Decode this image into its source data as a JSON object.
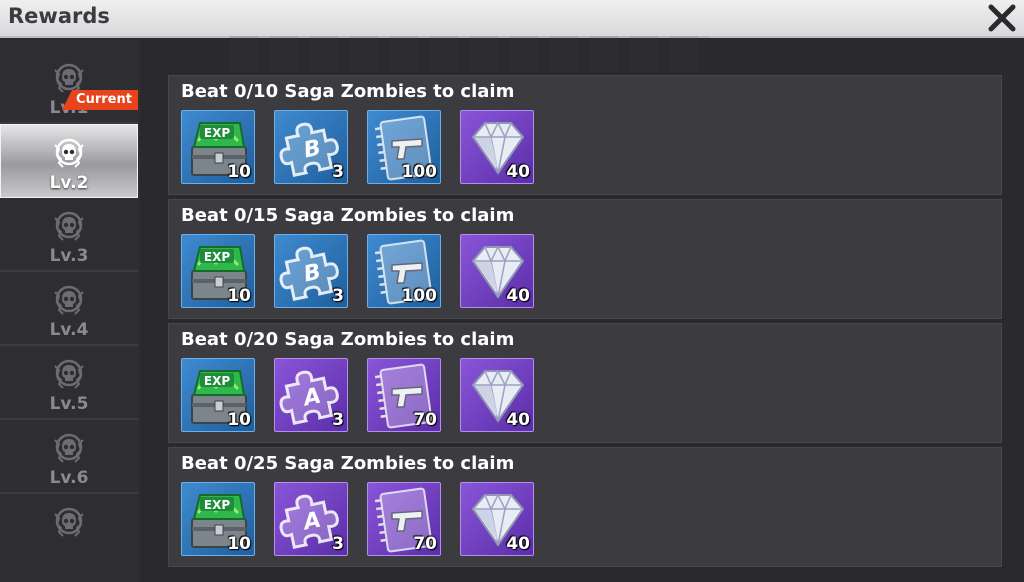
{
  "header": {
    "title": "Rewards"
  },
  "sidebar": {
    "current_badge": "Current",
    "levels": [
      "Lv.1",
      "Lv.2",
      "Lv.3",
      "Lv.4",
      "Lv.5",
      "Lv.6"
    ]
  },
  "rows": [
    {
      "title": "Beat 0/10 Saga Zombies to claim",
      "items": [
        {
          "icon": "exp-chest-icon",
          "color": "blue",
          "qty": "10"
        },
        {
          "icon": "puzzle-b-icon",
          "color": "blue",
          "qty": "3"
        },
        {
          "icon": "pistol-manual-icon",
          "color": "blue",
          "qty": "100"
        },
        {
          "icon": "diamond-icon",
          "color": "purple",
          "qty": "40"
        }
      ]
    },
    {
      "title": "Beat 0/15 Saga Zombies to claim",
      "items": [
        {
          "icon": "exp-chest-icon",
          "color": "blue",
          "qty": "10"
        },
        {
          "icon": "puzzle-b-icon",
          "color": "blue",
          "qty": "3"
        },
        {
          "icon": "pistol-manual-icon",
          "color": "blue",
          "qty": "100"
        },
        {
          "icon": "diamond-icon",
          "color": "purple",
          "qty": "40"
        }
      ]
    },
    {
      "title": "Beat 0/20 Saga Zombies to claim",
      "items": [
        {
          "icon": "exp-chest-icon",
          "color": "blue",
          "qty": "10"
        },
        {
          "icon": "puzzle-a-icon",
          "color": "purple",
          "qty": "3"
        },
        {
          "icon": "pistol-manual-icon",
          "color": "purple",
          "qty": "70"
        },
        {
          "icon": "diamond-icon",
          "color": "purple",
          "qty": "40"
        }
      ]
    },
    {
      "title": "Beat 0/25 Saga Zombies to claim",
      "items": [
        {
          "icon": "exp-chest-icon",
          "color": "blue",
          "qty": "10"
        },
        {
          "icon": "puzzle-a-icon",
          "color": "purple",
          "qty": "3"
        },
        {
          "icon": "pistol-manual-icon",
          "color": "purple",
          "qty": "70"
        },
        {
          "icon": "diamond-icon",
          "color": "purple",
          "qty": "40"
        }
      ]
    }
  ],
  "colors": {
    "accent_badge": "#e8441c",
    "rarity_blue": "#2f78c0",
    "rarity_purple": "#7a46c8",
    "panel": "#3b3b40"
  }
}
